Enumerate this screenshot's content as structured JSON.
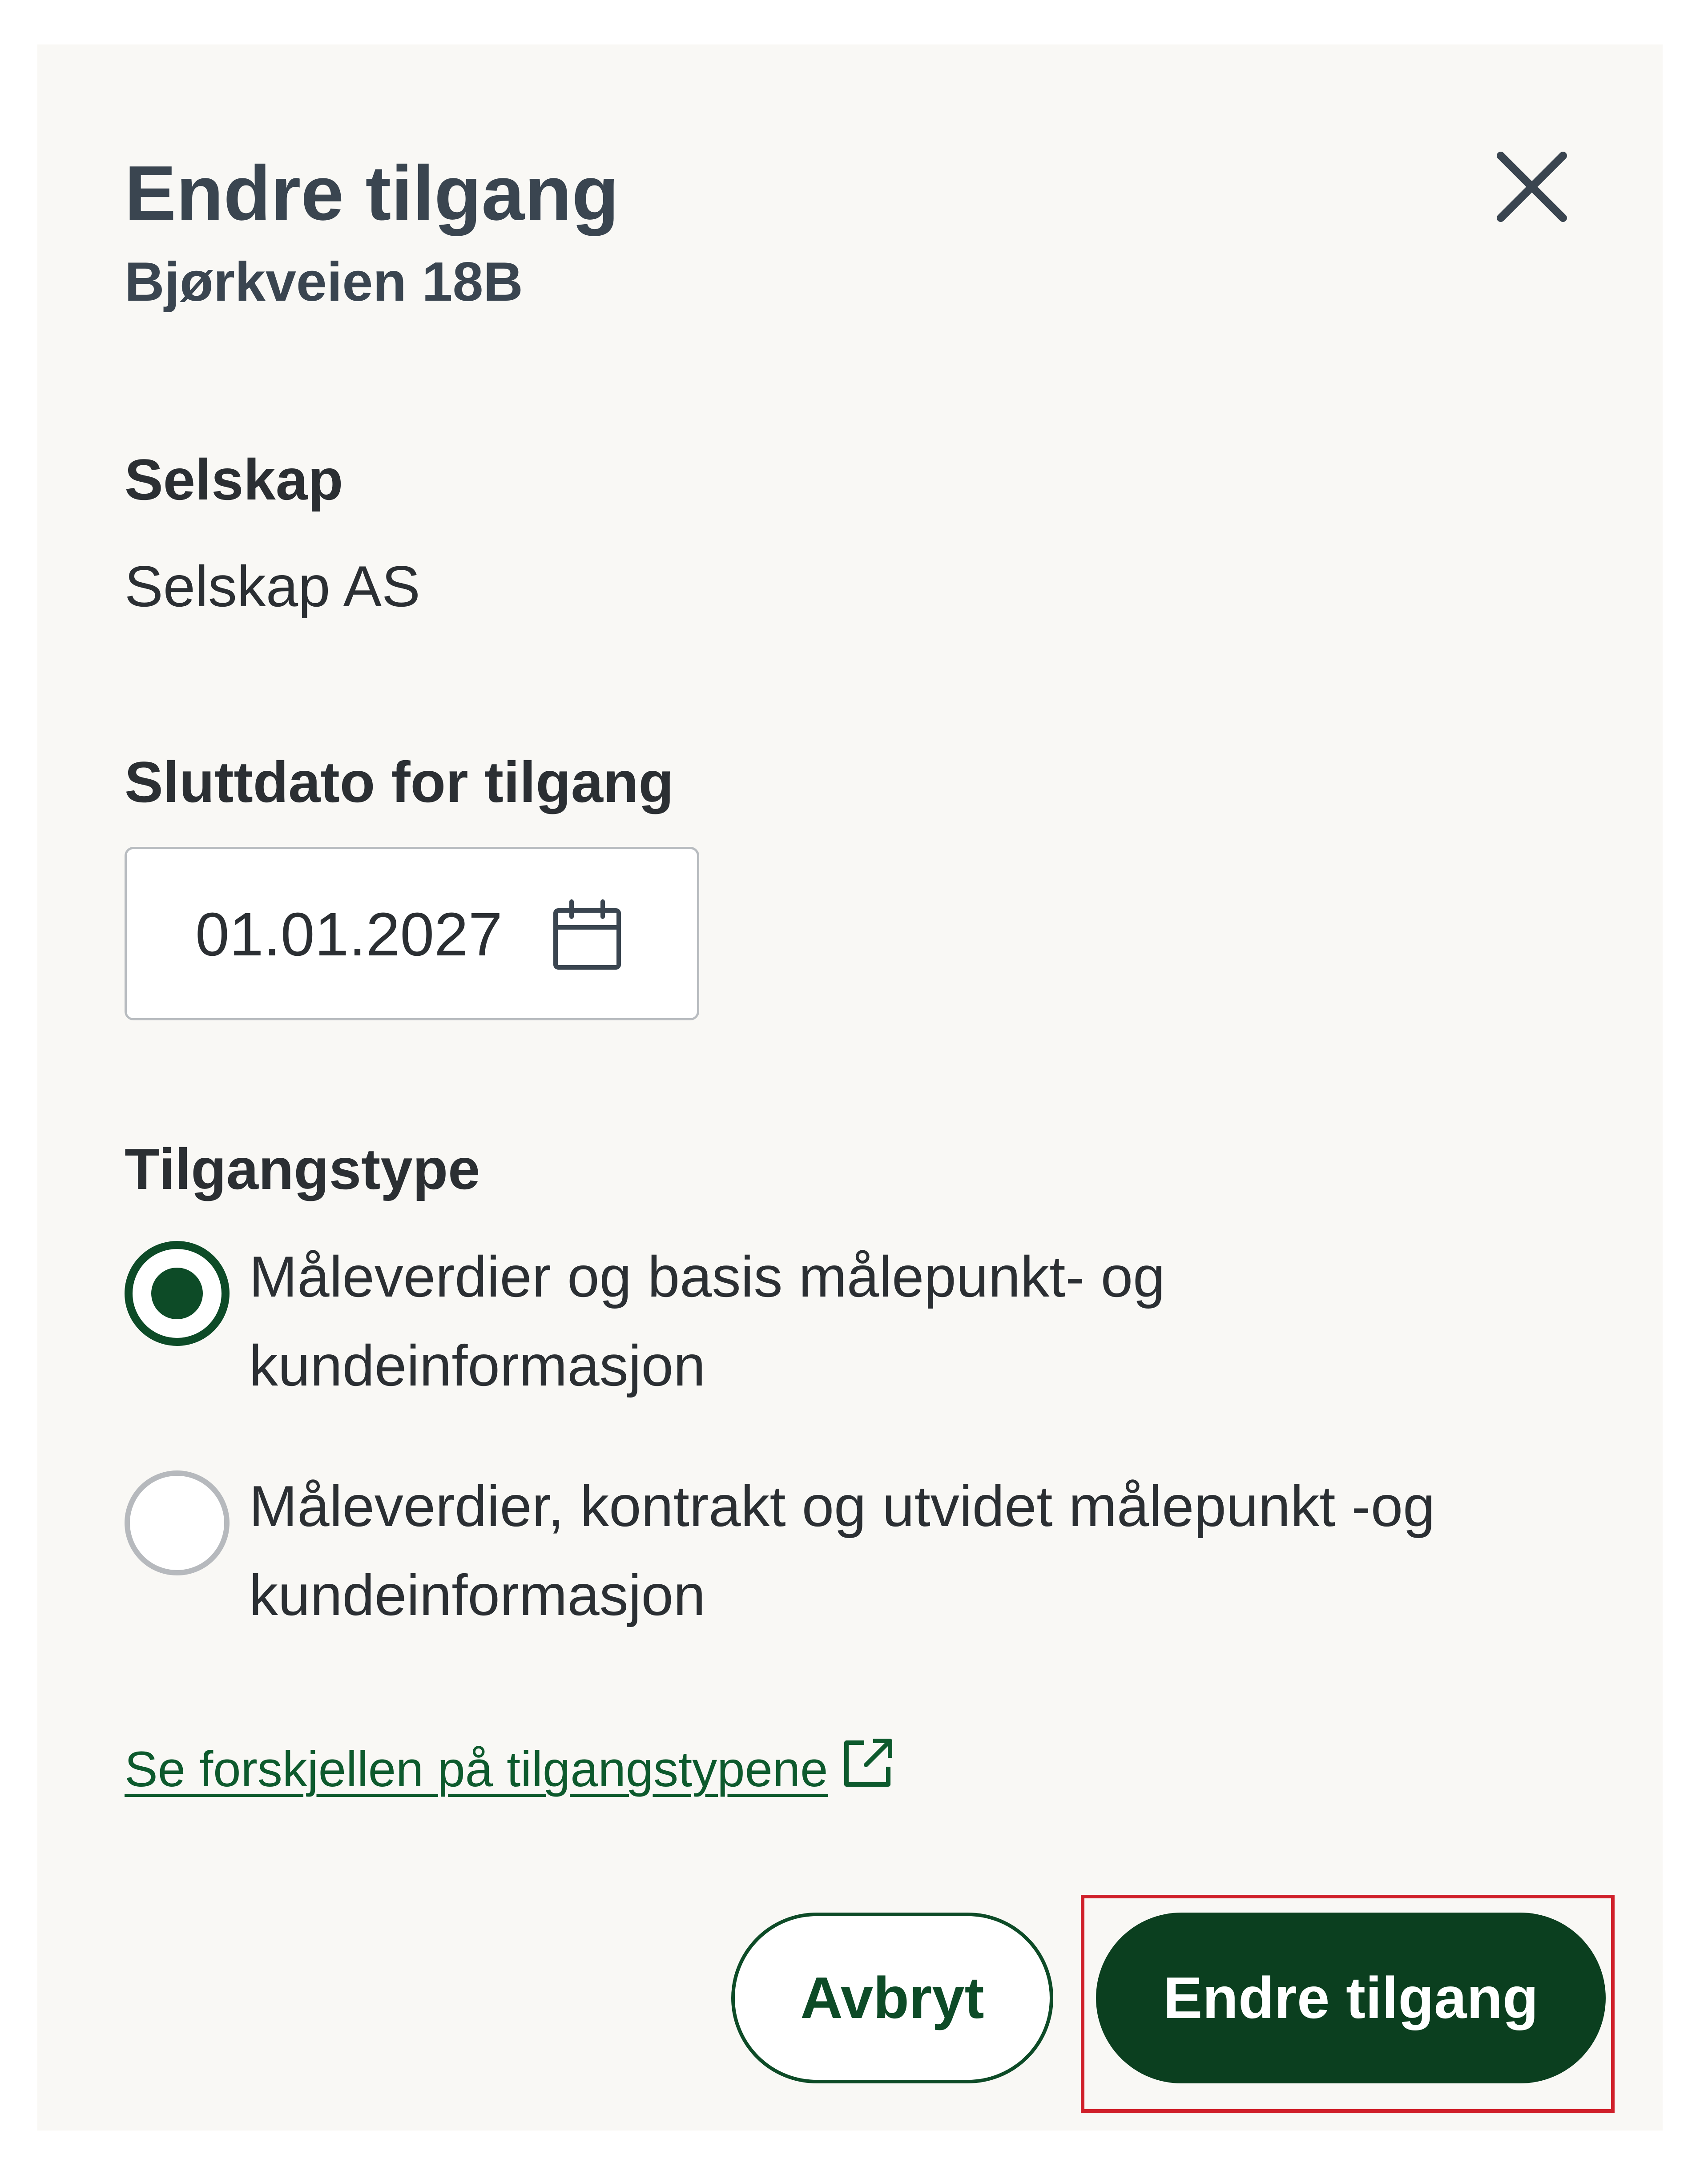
{
  "modal": {
    "title": "Endre tilgang",
    "subtitle": "Bjørkveien 18B"
  },
  "company": {
    "label": "Selskap",
    "value": "Selskap AS"
  },
  "end_date": {
    "label": "Sluttdato for tilgang",
    "value": "01.01.2027"
  },
  "access_type": {
    "label": "Tilgangstype",
    "options": [
      {
        "label": "Måleverdier og basis målepunkt- og kundeinformasjon",
        "selected": true
      },
      {
        "label": "Måleverdier, kontrakt og utvidet målepunkt -og kundeinformasjon",
        "selected": false
      }
    ]
  },
  "link": {
    "text": "Se forskjellen på tilgangstypene"
  },
  "actions": {
    "cancel_label": "Avbryt",
    "submit_label": "Endre tilgang"
  },
  "colors": {
    "accent": "#0b3f1f",
    "highlight": "#d0202a",
    "background": "#f9f8f5"
  },
  "icons": {
    "close": "close-icon",
    "calendar": "calendar-icon",
    "external": "external-link-icon"
  }
}
